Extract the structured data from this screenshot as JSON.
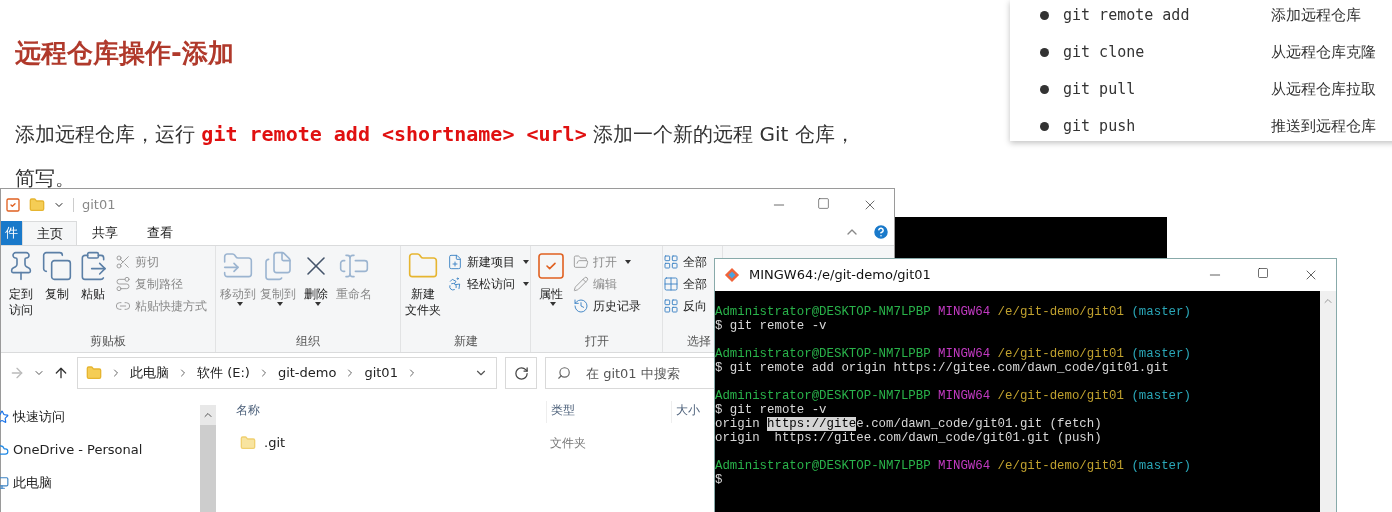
{
  "slide": {
    "heading": "远程仓库操作-添加",
    "paragraph": {
      "before": "添加远程仓库，运行 ",
      "code": "git remote add <shortname> <url>",
      "after": " 添加一个新的远程 Git 仓库，",
      "line_2": "简写。"
    }
  },
  "command_card": {
    "items": [
      {
        "command": "git remote add",
        "description": "添加远程仓库"
      },
      {
        "command": "git clone",
        "description": "从远程仓库克隆"
      },
      {
        "command": "git pull",
        "description": "从远程仓库拉取"
      },
      {
        "command": "git push",
        "description": "推送到远程仓库"
      }
    ]
  },
  "explorer": {
    "title": "git01",
    "ribbon_tabs": [
      {
        "label": "件",
        "kind": "file",
        "selected": false
      },
      {
        "label": "主页",
        "kind": "tab",
        "selected": true
      },
      {
        "label": "共享",
        "kind": "tab",
        "selected": false
      },
      {
        "label": "查看",
        "kind": "tab",
        "selected": false
      }
    ],
    "ribbon_groups": [
      {
        "label": "剪贴板",
        "buttons": [
          {
            "kind": "large",
            "lines": [
              "定到",
              "访问"
            ],
            "dropdown": false,
            "disabled": false
          },
          {
            "kind": "large",
            "lines": [
              "复制"
            ],
            "dropdown": false,
            "disabled": false
          },
          {
            "kind": "large",
            "lines": [
              "粘贴"
            ],
            "dropdown": false,
            "disabled": false
          },
          {
            "kind": "small",
            "lines": [
              "剪切"
            ],
            "dropdown": false,
            "disabled": true
          },
          {
            "kind": "small",
            "lines": [
              "复制路径"
            ],
            "dropdown": false,
            "disabled": true
          },
          {
            "kind": "small",
            "lines": [
              "粘贴快捷方式"
            ],
            "dropdown": false,
            "disabled": true
          }
        ]
      },
      {
        "label": "组织",
        "buttons": [
          {
            "kind": "large",
            "lines": [
              "移动到"
            ],
            "dropdown": true,
            "disabled": true
          },
          {
            "kind": "large",
            "lines": [
              "复制到"
            ],
            "dropdown": true,
            "disabled": true
          },
          {
            "kind": "large",
            "lines": [
              "删除"
            ],
            "dropdown": true,
            "disabled": false
          },
          {
            "kind": "large",
            "lines": [
              "重命名"
            ],
            "dropdown": false,
            "disabled": true
          }
        ]
      },
      {
        "label": "新建",
        "buttons": [
          {
            "kind": "large",
            "lines": [
              "新建",
              "文件夹"
            ],
            "dropdown": false,
            "disabled": false
          },
          {
            "kind": "small",
            "lines": [
              "新建项目"
            ],
            "dropdown": true,
            "disabled": false
          },
          {
            "kind": "small",
            "lines": [
              "轻松访问"
            ],
            "dropdown": true,
            "disabled": false
          }
        ]
      },
      {
        "label": "打开",
        "buttons": [
          {
            "kind": "large",
            "lines": [
              "属性"
            ],
            "dropdown": true,
            "disabled": false
          },
          {
            "kind": "small",
            "lines": [
              "打开"
            ],
            "dropdown": true,
            "disabled": true
          },
          {
            "kind": "small",
            "lines": [
              "编辑"
            ],
            "dropdown": false,
            "disabled": true
          },
          {
            "kind": "small",
            "lines": [
              "历史记录"
            ],
            "dropdown": false,
            "disabled": false
          }
        ]
      },
      {
        "label": "选择",
        "buttons": [
          {
            "kind": "small",
            "lines": [
              "全部"
            ],
            "dropdown": false,
            "disabled": false
          },
          {
            "kind": "small",
            "lines": [
              "全部"
            ],
            "dropdown": false,
            "disabled": false
          },
          {
            "kind": "small",
            "lines": [
              "反向"
            ],
            "dropdown": false,
            "disabled": false
          }
        ]
      }
    ],
    "breadcrumbs": [
      "此电脑",
      "软件 (E:)",
      "git-demo",
      "git01"
    ],
    "search": {
      "placeholder": "在 git01 中搜索"
    },
    "nav_items": [
      "快速访问",
      "OneDrive - Personal",
      "此电脑"
    ],
    "columns": [
      "名称",
      "类型",
      "大小"
    ],
    "rows": [
      {
        "name": ".git",
        "type": "文件夹"
      }
    ]
  },
  "terminal": {
    "title": "MINGW64:/e/git-demo/git01",
    "lines": [
      {
        "kind": "prompt",
        "user": "Administrator@DESKTOP-NM7LPBP",
        "system": "MINGW64",
        "path": "/e/git-demo/git01",
        "branch": "(master)"
      },
      {
        "kind": "command",
        "text": "$ git remote -v"
      },
      {
        "kind": "prompt",
        "user": "Administrator@DESKTOP-NM7LPBP",
        "system": "MINGW64",
        "path": "/e/git-demo/git01",
        "branch": "(master)"
      },
      {
        "kind": "command",
        "text": "$ git remote add origin https://gitee.com/dawn_code/git01.git"
      },
      {
        "kind": "prompt",
        "user": "Administrator@DESKTOP-NM7LPBP",
        "system": "MINGW64",
        "path": "/e/git-demo/git01",
        "branch": "(master)"
      },
      {
        "kind": "command",
        "text": "$ git remote -v"
      },
      {
        "kind": "output",
        "segments": [
          {
            "text": "origin ",
            "selected": false
          },
          {
            "text": "https://gite",
            "selected": true
          },
          {
            "text": "e.com/dawn_code/git01.git (fetch)",
            "selected": false
          }
        ]
      },
      {
        "kind": "output",
        "segments": [
          {
            "text": "origin  https://gitee.com/dawn_code/git01.git (push)",
            "selected": false
          }
        ]
      },
      {
        "kind": "prompt",
        "user": "Administrator@DESKTOP-NM7LPBP",
        "system": "MINGW64",
        "path": "/e/git-demo/git01",
        "branch": "(master)"
      },
      {
        "kind": "command",
        "text": "$"
      }
    ]
  }
}
